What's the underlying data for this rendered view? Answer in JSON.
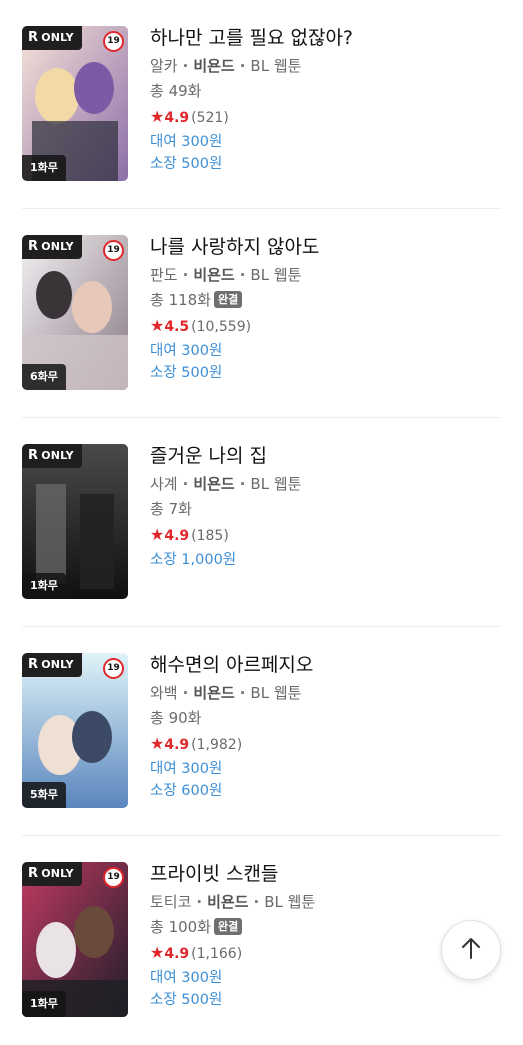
{
  "items": [
    {
      "title": "하나만 고를 필요 없잖아?",
      "author": "알카",
      "publisher": "비욘드",
      "genre": "BL 웹툰",
      "episodes": "총 49화",
      "completed": "",
      "rating": "4.9",
      "rating_count": "(521)",
      "rent": "대여 300원",
      "own": "소장 500원",
      "r_badge": "ONLY",
      "age": "19",
      "free": "1화무",
      "colors": [
        "#f2d9d9",
        "#8b6fa8"
      ]
    },
    {
      "title": "나를 사랑하지 않아도",
      "author": "판도",
      "publisher": "비욘드",
      "genre": "BL 웹툰",
      "episodes": "총 118화",
      "completed": "완결",
      "rating": "4.5",
      "rating_count": "(10,559)",
      "rent": "대여 300원",
      "own": "소장 500원",
      "r_badge": "ONLY",
      "age": "19",
      "free": "6화무",
      "colors": [
        "#e9e6ea",
        "#7a6a72"
      ]
    },
    {
      "title": "즐거운 나의 집",
      "author": "사계",
      "publisher": "비욘드",
      "genre": "BL 웹툰",
      "episodes": "총 7화",
      "completed": "",
      "rating": "4.9",
      "rating_count": "(185)",
      "rent": "",
      "own": "소장 1,000원",
      "r_badge": "ONLY",
      "age": "",
      "free": "1화무",
      "colors": [
        "#3a3a3a",
        "#141414"
      ]
    },
    {
      "title": "해수면의 아르페지오",
      "author": "와백",
      "publisher": "비욘드",
      "genre": "BL 웹툰",
      "episodes": "총 90화",
      "completed": "",
      "rating": "4.9",
      "rating_count": "(1,982)",
      "rent": "대여 300원",
      "own": "소장 600원",
      "r_badge": "ONLY",
      "age": "19",
      "free": "5화무",
      "colors": [
        "#bfe6f2",
        "#6a8fbf"
      ]
    },
    {
      "title": "프라이빗 스캔들",
      "author": "토티코",
      "publisher": "비욘드",
      "genre": "BL 웹툰",
      "episodes": "총 100화",
      "completed": "완결",
      "rating": "4.9",
      "rating_count": "(1,166)",
      "rent": "대여 300원",
      "own": "소장 500원",
      "r_badge": "ONLY",
      "age": "19",
      "free": "1화무",
      "colors": [
        "#b7385c",
        "#2a2a3a"
      ]
    }
  ],
  "colors": {
    "accent_red": "#e0272b",
    "price_blue": "#3d8fd6"
  },
  "scroll_top_icon": "arrow-up-icon"
}
